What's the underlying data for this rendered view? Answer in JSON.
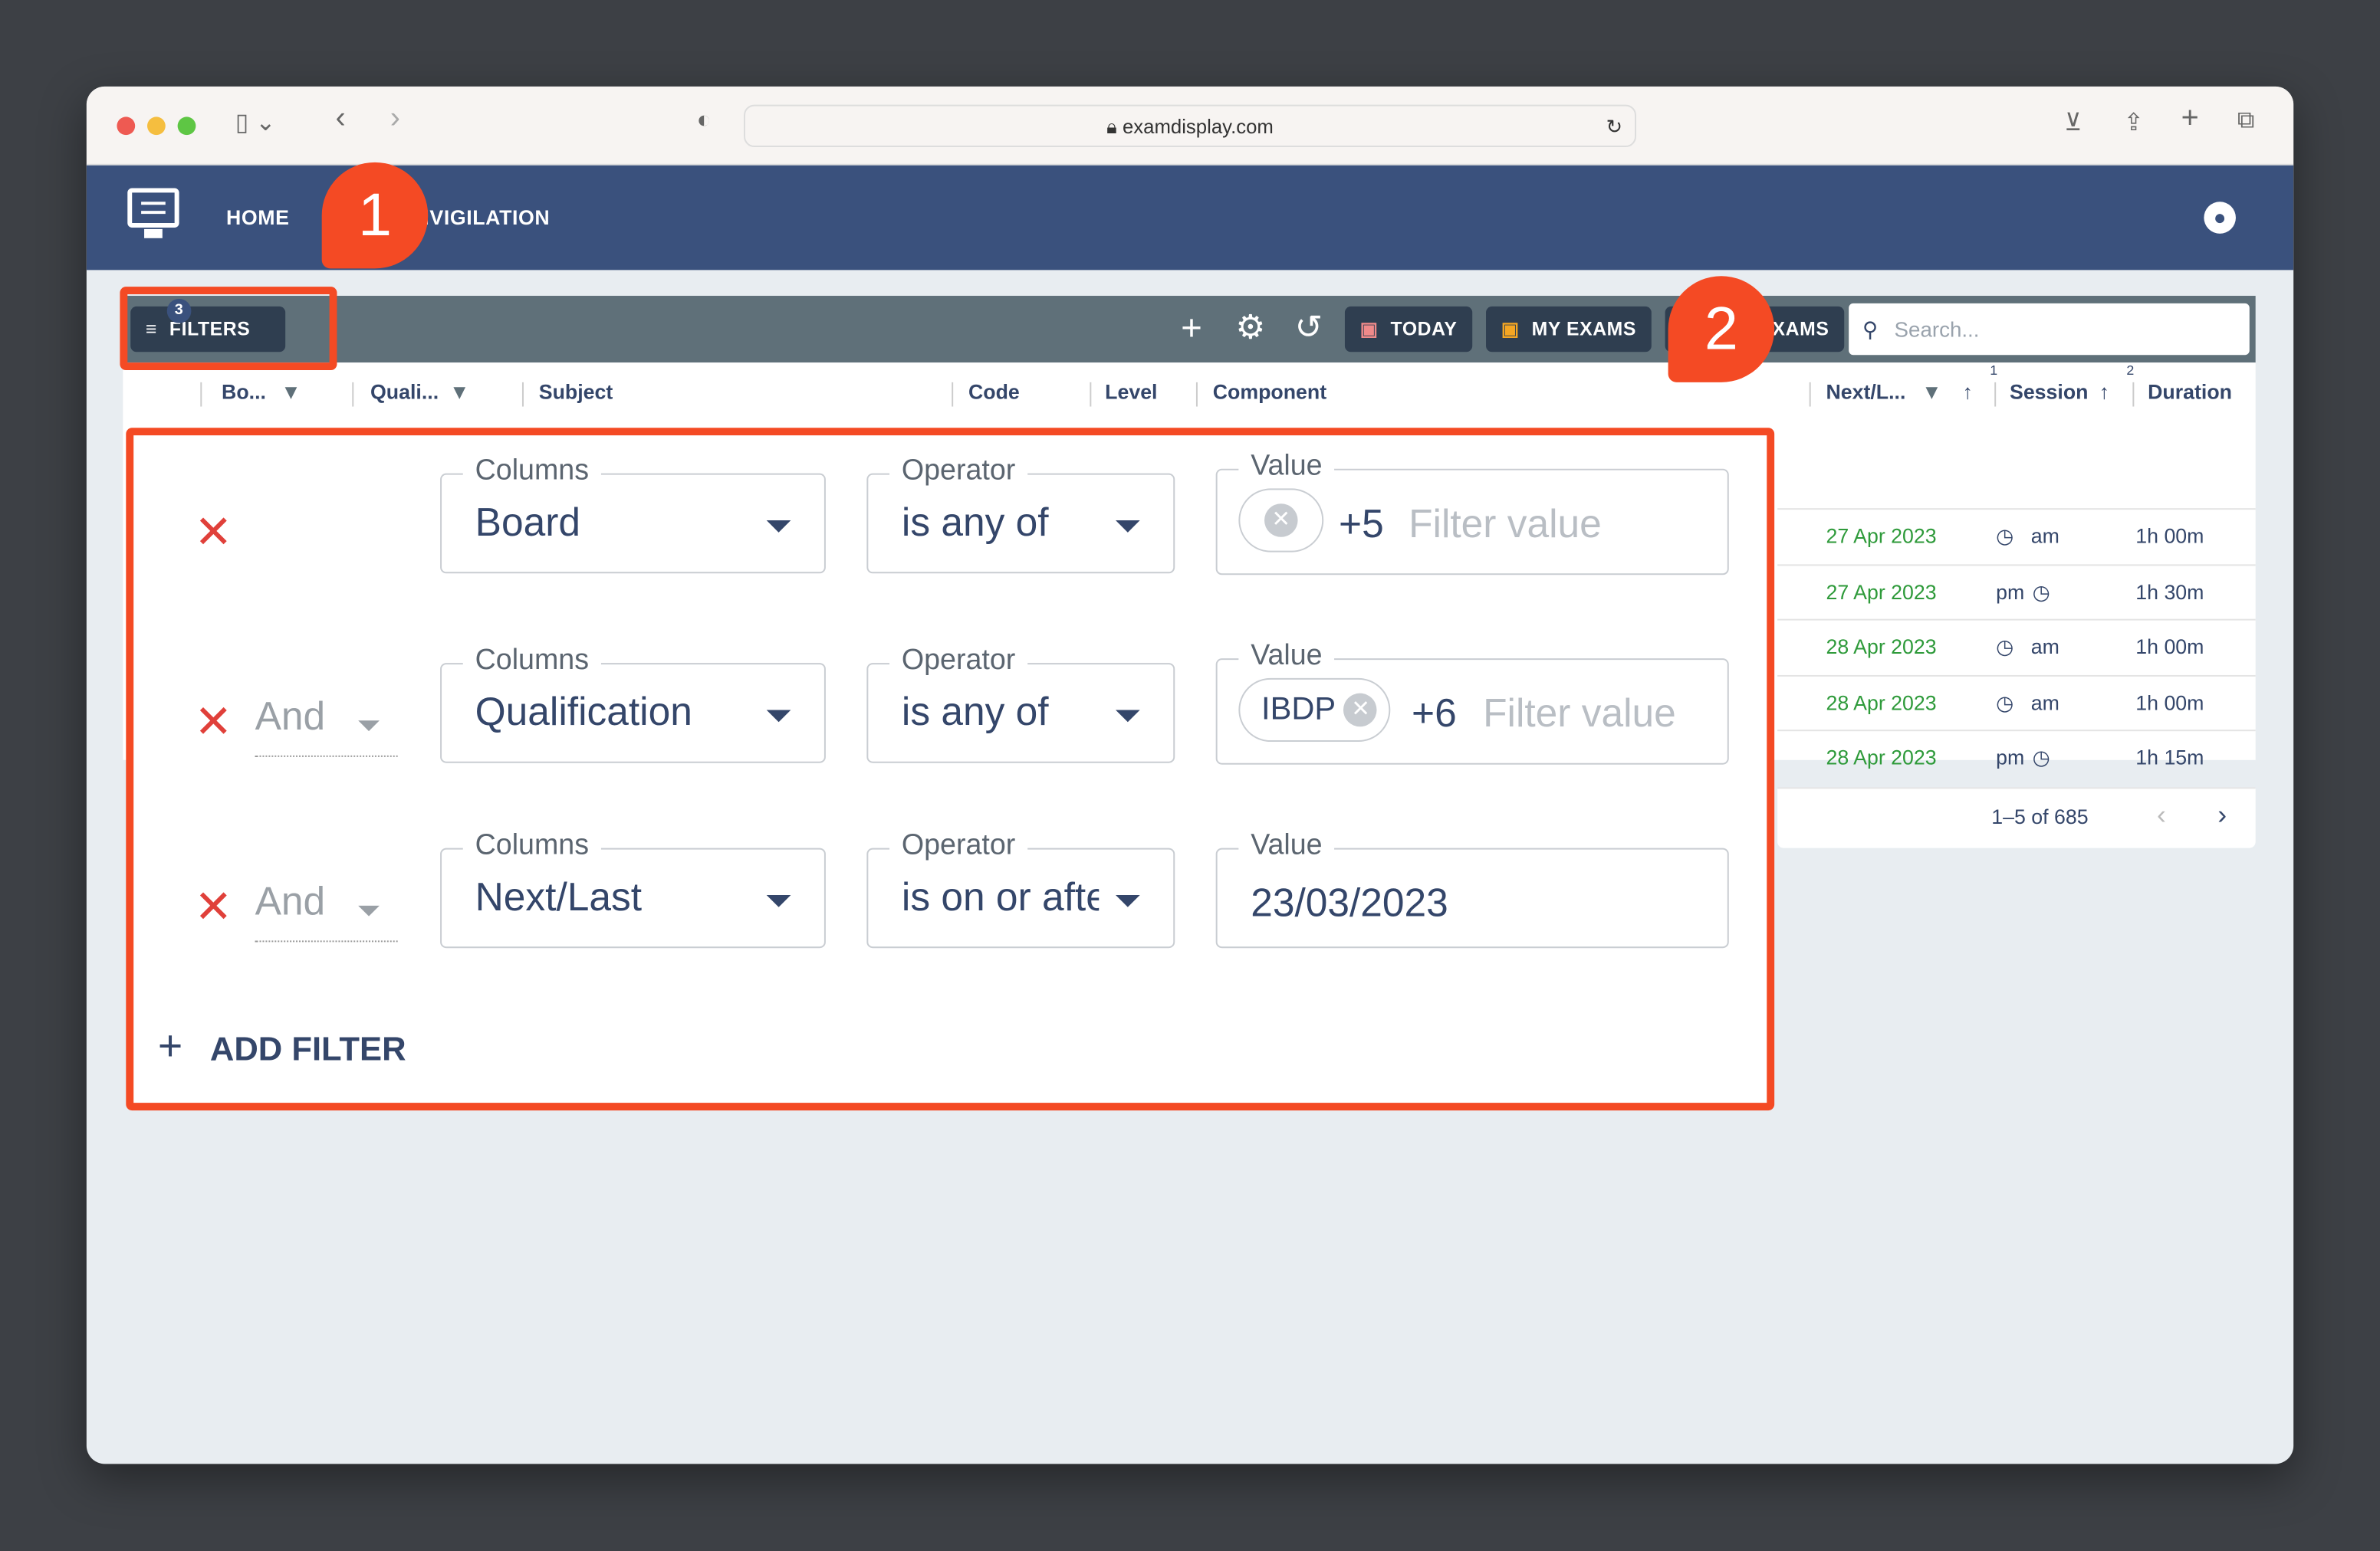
{
  "browser": {
    "url": "examdisplay.com"
  },
  "nav": {
    "home": "HOME",
    "invigilation": "INVIGILATION"
  },
  "toolbar": {
    "filters_label": "FILTERS",
    "filters_count": "3",
    "today": "TODAY",
    "my_exams": "MY EXAMS",
    "all_exams": "EXAMS",
    "search_placeholder": "Search..."
  },
  "columns": [
    {
      "label": "Bo..."
    },
    {
      "label": "Quali..."
    },
    {
      "label": "Subject"
    },
    {
      "label": "Code"
    },
    {
      "label": "Level"
    },
    {
      "label": "Component"
    },
    {
      "label": "Next/L...",
      "sort_order": "1"
    },
    {
      "label": "Session",
      "sort_order": "2"
    },
    {
      "label": "Duration"
    }
  ],
  "rows": [
    {
      "date": "27 Apr 2023",
      "session": "am",
      "duration": "1h 00m"
    },
    {
      "date": "27 Apr 2023",
      "session": "pm",
      "duration": "1h 30m"
    },
    {
      "date": "28 Apr 2023",
      "session": "am",
      "duration": "1h 00m"
    },
    {
      "date": "28 Apr 2023",
      "session": "am",
      "duration": "1h 00m"
    },
    {
      "date": "28 Apr 2023",
      "session": "pm",
      "duration": "1h 15m"
    }
  ],
  "pagination": {
    "text": "1–5 of 685"
  },
  "filter_panel": {
    "columns_label": "Columns",
    "operator_label": "Operator",
    "value_label": "Value",
    "placeholder": "Filter value",
    "add_filter": "ADD FILTER",
    "filters": [
      {
        "logic": "",
        "column": "Board",
        "operator": "is any of",
        "chip": "",
        "more": "+5"
      },
      {
        "logic": "And",
        "column": "Qualification",
        "operator": "is any of",
        "chip": "IBDP",
        "more": "+6"
      },
      {
        "logic": "And",
        "column": "Next/Last",
        "operator": "is on or after",
        "value": "23/03/2023"
      }
    ]
  },
  "callouts": [
    "1",
    "2"
  ],
  "colors": {
    "nav": "#3a517d",
    "toolbar": "#5f7079",
    "highlight": "#f44a24",
    "date_green": "#2e9a3a"
  }
}
